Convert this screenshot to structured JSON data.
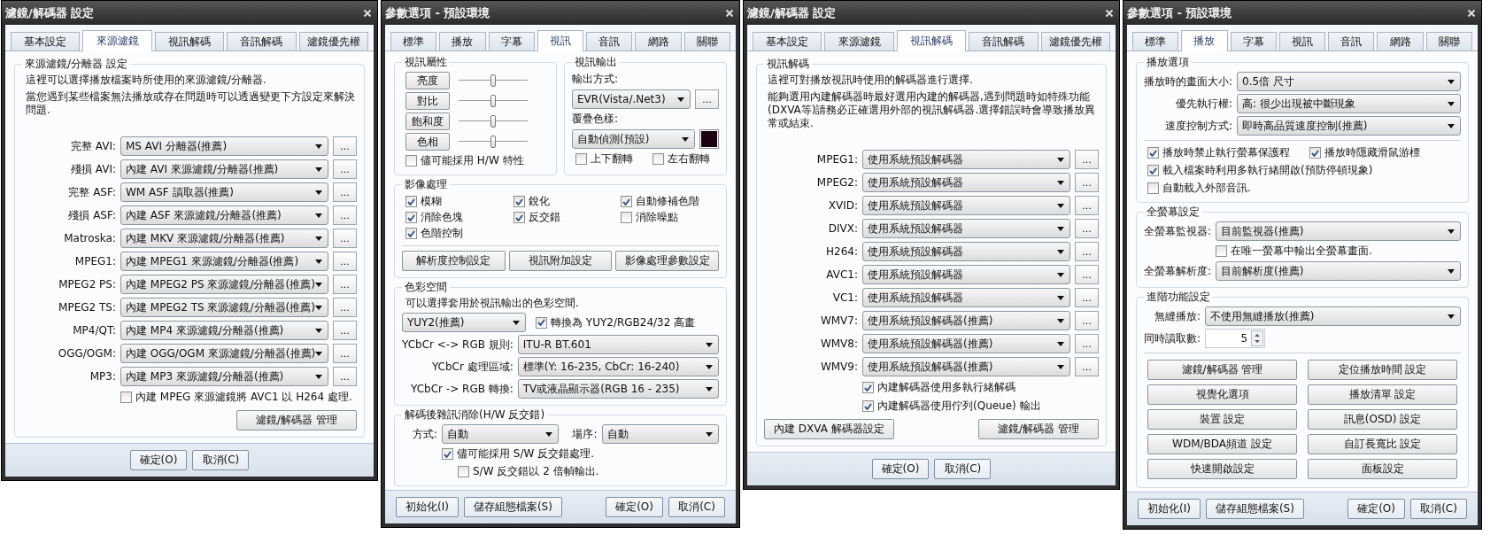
{
  "windows": [
    {
      "kind": "filter_dialog",
      "title": "濾鏡/解碼器 設定",
      "tabs": [
        {
          "label": "基本設定",
          "selected": false
        },
        {
          "label": "來源濾鏡",
          "selected": true
        },
        {
          "label": "視訊解碼",
          "selected": false
        },
        {
          "label": "音訊解碼",
          "selected": false
        },
        {
          "label": "濾鏡優先權",
          "selected": false
        }
      ],
      "blocks": [
        {
          "kind": "group",
          "title": "來源濾鏡/分離器 設定",
          "blocks": [
            {
              "kind": "text",
              "text": "這裡可以選擇播放檔案時所使用的來源濾鏡/分離器."
            },
            {
              "kind": "text",
              "text": "當您遇到某些檔案無法播放或存在問題時可以透過變更下方設定來解決問題."
            },
            {
              "kind": "spacer"
            },
            {
              "kind": "combo_row",
              "label": "完整 AVI:",
              "value": "MS AVI 分離器(推薦)",
              "more": "..."
            },
            {
              "kind": "combo_row",
              "label": "殘損 AVI:",
              "value": "內建 AVI 來源濾鏡/分離器(推薦)",
              "more": "..."
            },
            {
              "kind": "combo_row",
              "label": "完整 ASF:",
              "value": "WM ASF 讀取器(推薦)",
              "more": "..."
            },
            {
              "kind": "combo_row",
              "label": "殘損 ASF:",
              "value": "內建 ASF 來源濾鏡/分離器(推薦)",
              "more": "..."
            },
            {
              "kind": "combo_row",
              "label": "Matroska:",
              "value": "內建 MKV 來源濾鏡/分離器(推薦)",
              "more": "..."
            },
            {
              "kind": "combo_row",
              "label": "MPEG1:",
              "value": "內建 MPEG1 來源濾鏡/分離器(推薦)",
              "more": "..."
            },
            {
              "kind": "combo_row",
              "label": "MPEG2 PS:",
              "value": "內建 MPEG2 PS 來源濾鏡/分離器(推薦)",
              "more": "..."
            },
            {
              "kind": "combo_row",
              "label": "MPEG2 TS:",
              "value": "內建 MPEG2 TS 來源濾鏡/分離器(推薦)",
              "more": "..."
            },
            {
              "kind": "combo_row",
              "label": "MP4/QT:",
              "value": "內建 MP4 來源濾鏡/分離器(推薦)",
              "more": "..."
            },
            {
              "kind": "combo_row",
              "label": "OGG/OGM:",
              "value": "內建 OGG/OGM 來源濾鏡/分離器(推薦)",
              "more": "..."
            },
            {
              "kind": "combo_row",
              "label": "MP3:",
              "value": "內建 MP3 來源濾鏡/分離器(推薦)",
              "more": "..."
            },
            {
              "kind": "checkbox",
              "label": "內建 MPEG 來源濾鏡將 AVC1 以 H264 處理.",
              "checked": false
            },
            {
              "kind": "button_row",
              "buttons": [
                "濾鏡/解碼器 管理"
              ]
            }
          ]
        }
      ],
      "footer": {
        "center": [
          "確定(O)",
          "取消(C)"
        ]
      }
    },
    {
      "kind": "options_dialog",
      "title": "參數選項 - 預設環境",
      "tabs": [
        {
          "label": "標準",
          "selected": false
        },
        {
          "label": "播放",
          "selected": false
        },
        {
          "label": "字幕",
          "selected": false
        },
        {
          "label": "視訊",
          "selected": true
        },
        {
          "label": "音訊",
          "selected": false
        },
        {
          "label": "網路",
          "selected": false
        },
        {
          "label": "關聯",
          "selected": false
        }
      ],
      "blocks": [
        {
          "kind": "columns",
          "groups": [
            {
              "kind": "group",
              "title": "視訊屬性",
              "blocks": [
                {
                  "kind": "slider_row",
                  "label": "亮度",
                  "level": 0.5
                },
                {
                  "kind": "slider_row",
                  "label": "對比",
                  "level": 0.5
                },
                {
                  "kind": "slider_row",
                  "label": "飽和度",
                  "level": 0.5
                },
                {
                  "kind": "slider_row",
                  "label": "色相",
                  "level": 0.5
                },
                {
                  "kind": "checkbox",
                  "label": "儘可能採用 H/W 特性",
                  "checked": false
                }
              ]
            },
            {
              "kind": "group",
              "title": "視訊輸出",
              "blocks": [
                {
                  "kind": "label",
                  "text": "輸出方式:"
                },
                {
                  "kind": "combo_row",
                  "value": "EVR(Vista/.Net3)",
                  "more": "..."
                },
                {
                  "kind": "label",
                  "text": "覆疊色樣:"
                },
                {
                  "kind": "color_row",
                  "value": "自動偵測(預設)",
                  "color": "#1a0010"
                },
                {
                  "kind": "checkbox_row",
                  "items": [
                    {
                      "label": "上下翻轉",
                      "checked": false
                    },
                    {
                      "label": "左右翻轉",
                      "checked": false
                    }
                  ]
                }
              ]
            }
          ]
        },
        {
          "kind": "group",
          "title": "影像處理",
          "blocks": [
            {
              "kind": "checkbox_grid",
              "items": [
                {
                  "label": "模糊",
                  "checked": true
                },
                {
                  "label": "銳化",
                  "checked": true
                },
                {
                  "label": "自動修補色階",
                  "checked": true
                },
                {
                  "label": "消除色塊",
                  "checked": true
                },
                {
                  "label": "反交錯",
                  "checked": true
                },
                {
                  "label": "消除噪點",
                  "checked": false
                },
                {
                  "label": "色階控制",
                  "checked": true
                }
              ]
            },
            {
              "kind": "separator"
            },
            {
              "kind": "button_strip",
              "buttons": [
                "解析度控制設定",
                "視訊附加設定",
                "影像處理參數設定"
              ]
            }
          ]
        },
        {
          "kind": "group",
          "title": "色彩空間",
          "blocks": [
            {
              "kind": "text",
              "text": "可以選擇套用於視訊輸出的色彩空間."
            },
            {
              "kind": "combo_check",
              "value": "YUY2(推薦)",
              "checkbox": {
                "label": "轉換為 YUY2/RGB24/32 高畫",
                "checked": true
              }
            },
            {
              "kind": "combo_row",
              "label": "YCbCr <-> RGB 規則:",
              "value": "ITU-R BT.601"
            },
            {
              "kind": "combo_row",
              "label": "YCbCr 處理區域:",
              "value": "標準(Y: 16-235, CbCr: 16-240)"
            },
            {
              "kind": "combo_row",
              "label": "YCbCr -> RGB 轉換:",
              "value": "TV或液晶顯示器(RGB 16 - 235)"
            }
          ]
        },
        {
          "kind": "group",
          "title": "解碼後雜訊消除(H/W 反交錯)",
          "blocks": [
            {
              "kind": "combo_pair",
              "items": [
                {
                  "label": "方式:",
                  "value": "自動"
                },
                {
                  "label": "場序:",
                  "value": "自動"
                }
              ]
            },
            {
              "kind": "checkbox",
              "label": "儘可能採用 S/W 反交錯處理.",
              "checked": true,
              "children": [
                {
                  "kind": "checkbox",
                  "label": "S/W 反交錯以 2 倍幀輸出.",
                  "checked": false
                }
              ]
            }
          ]
        }
      ],
      "footer": {
        "left": [
          "初始化(I)",
          "儲存組態檔案(S)"
        ],
        "right": [
          "確定(O)",
          "取消(C)"
        ]
      }
    },
    {
      "kind": "filter_dialog",
      "title": "濾鏡/解碼器 設定",
      "tabs": [
        {
          "label": "基本設定",
          "selected": false
        },
        {
          "label": "來源濾鏡",
          "selected": false
        },
        {
          "label": "視訊解碼",
          "selected": true
        },
        {
          "label": "音訊解碼",
          "selected": false
        },
        {
          "label": "濾鏡優先權",
          "selected": false
        }
      ],
      "blocks": [
        {
          "kind": "group",
          "title": "視訊解碼",
          "blocks": [
            {
              "kind": "text",
              "text": "這裡可對播放視訊時使用的解碼器進行選擇."
            },
            {
              "kind": "text",
              "text": "能夠選用內建解碼器時最好選用內建的解碼器,遇到問題時如特殊功能(DXVA等)請務必正確選用外部的視訊解碼器.選擇錯誤時會導致播放異常或結束."
            },
            {
              "kind": "spacer"
            },
            {
              "kind": "combo_row",
              "label": "MPEG1:",
              "value": "使用系統預設解碼器",
              "more": "..."
            },
            {
              "kind": "combo_row",
              "label": "MPEG2:",
              "value": "使用系統預設解碼器",
              "more": "..."
            },
            {
              "kind": "combo_row",
              "label": "XVID:",
              "value": "使用系統預設解碼器",
              "more": "..."
            },
            {
              "kind": "combo_row",
              "label": "DIVX:",
              "value": "使用系統預設解碼器",
              "more": "..."
            },
            {
              "kind": "combo_row",
              "label": "H264:",
              "value": "使用系統預設解碼器",
              "more": "..."
            },
            {
              "kind": "combo_row",
              "label": "AVC1:",
              "value": "使用系統預設解碼器",
              "more": "..."
            },
            {
              "kind": "combo_row",
              "label": "VC1:",
              "value": "使用系統預設解碼器",
              "more": "..."
            },
            {
              "kind": "combo_row",
              "label": "WMV7:",
              "value": "使用系統預設解碼器(推薦)",
              "more": "..."
            },
            {
              "kind": "combo_row",
              "label": "WMV8:",
              "value": "使用系統預設解碼器(推薦)",
              "more": "..."
            },
            {
              "kind": "combo_row",
              "label": "WMV9:",
              "value": "使用系統預設解碼器(推薦)",
              "more": "..."
            },
            {
              "kind": "checkbox",
              "label": "內建解碼器使用多執行緒解碼",
              "checked": true
            },
            {
              "kind": "checkbox",
              "label": "內建解碼器使用佇列(Queue) 輸出",
              "checked": true
            },
            {
              "kind": "button_row",
              "buttons": [
                "內建 DXVA 解碼器設定",
                "濾鏡/解碼器 管理"
              ]
            }
          ]
        }
      ],
      "footer": {
        "center": [
          "確定(O)",
          "取消(C)"
        ]
      }
    },
    {
      "kind": "options_dialog",
      "title": "參數選項 - 預設環境",
      "tabs": [
        {
          "label": "標準",
          "selected": false
        },
        {
          "label": "播放",
          "selected": true
        },
        {
          "label": "字幕",
          "selected": false
        },
        {
          "label": "視訊",
          "selected": false
        },
        {
          "label": "音訊",
          "selected": false
        },
        {
          "label": "網路",
          "selected": false
        },
        {
          "label": "關聯",
          "selected": false
        }
      ],
      "blocks": [
        {
          "kind": "group",
          "title": "播放選項",
          "blocks": [
            {
              "kind": "combo_row",
              "label": "播放時的畫面大小:",
              "value": "0.5倍 尺寸"
            },
            {
              "kind": "combo_row",
              "label": "優先執行權:",
              "value": "高: 很少出現被中斷現象"
            },
            {
              "kind": "combo_row",
              "label": "速度控制方式:",
              "value": "即時高品質速度控制(推薦)"
            },
            {
              "kind": "separator"
            },
            {
              "kind": "checkbox_row",
              "items": [
                {
                  "label": "播放時禁止執行螢幕保護程",
                  "checked": true
                },
                {
                  "label": "播放時隱藏滑鼠游標",
                  "checked": true
                }
              ]
            },
            {
              "kind": "checkbox",
              "label": "載入檔案時利用多執行緒開啟(預防停頓現象)",
              "checked": true
            },
            {
              "kind": "checkbox",
              "label": "自動載入外部音訊.",
              "checked": false
            }
          ]
        },
        {
          "kind": "group",
          "title": "全螢幕設定",
          "blocks": [
            {
              "kind": "combo_row",
              "label": "全螢幕監視器:",
              "value": "目前監視器(推薦)"
            },
            {
              "kind": "checkbox",
              "label": "在唯一螢幕中輸出全螢幕畫面.",
              "checked": false
            },
            {
              "kind": "combo_row",
              "label": "全螢幕解析度:",
              "value": "目前解析度(推薦)"
            }
          ]
        },
        {
          "kind": "group",
          "title": "進階功能設定",
          "blocks": [
            {
              "kind": "combo_row",
              "label": "無縫播放:",
              "value": "不使用無縫播放(推薦)"
            },
            {
              "kind": "spin_row",
              "label": "同時讀取數:",
              "value": "5"
            },
            {
              "kind": "separator"
            },
            {
              "kind": "button_grid",
              "buttons": [
                "濾鏡/解碼器 管理",
                "定位播放時間 設定",
                "視覺化選項",
                "播放清單 設定",
                "裝置 設定",
                "訊息(OSD) 設定",
                "WDM/BDA頻道 設定",
                "自訂長寬比 設定",
                "快速開啟設定",
                "面板設定"
              ]
            }
          ]
        }
      ],
      "footer": {
        "left": [
          "初始化(I)",
          "儲存組態檔案(S)"
        ],
        "right": [
          "確定(O)",
          "取消(C)"
        ]
      }
    }
  ]
}
